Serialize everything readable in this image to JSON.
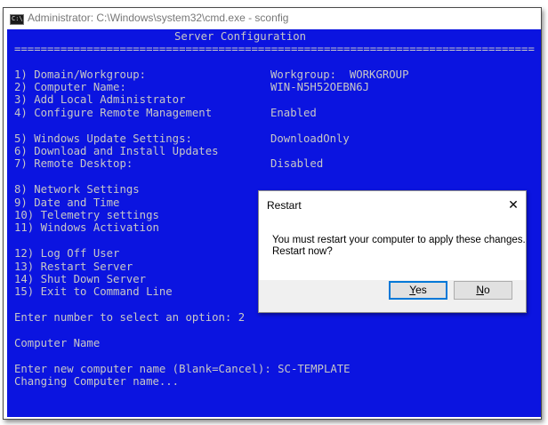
{
  "window": {
    "title": "Administrator: C:\\Windows\\system32\\cmd.exe - sconfig",
    "icon": "cmd-console-icon",
    "icon_label": "C:\\"
  },
  "console": {
    "heading": "Server Configuration",
    "separator": "===============================================================================",
    "menu": [
      {
        "label": "1) Domain/Workgroup:",
        "value": "Workgroup:  WORKGROUP"
      },
      {
        "label": "2) Computer Name:",
        "value": "WIN-N5H52OEBN6J"
      },
      {
        "label": "3) Add Local Administrator",
        "value": ""
      },
      {
        "label": "4) Configure Remote Management",
        "value": "Enabled"
      },
      {
        "label": "5) Windows Update Settings:",
        "value": "DownloadOnly"
      },
      {
        "label": "6) Download and Install Updates",
        "value": ""
      },
      {
        "label": "7) Remote Desktop:",
        "value": "Disabled"
      },
      {
        "label": "8) Network Settings",
        "value": ""
      },
      {
        "label": "9) Date and Time",
        "value": ""
      },
      {
        "label": "10) Telemetry settings",
        "value": ""
      },
      {
        "label": "11) Windows Activation",
        "value": ""
      },
      {
        "label": "12) Log Off User",
        "value": ""
      },
      {
        "label": "13) Restart Server",
        "value": ""
      },
      {
        "label": "14) Shut Down Server",
        "value": ""
      },
      {
        "label": "15) Exit to Command Line",
        "value": ""
      }
    ],
    "prompt": "Enter number to select an option: 2",
    "section": "Computer Name",
    "name_prompt": "Enter new computer name (Blank=Cancel): SC-TEMPLATE",
    "status": "Changing Computer name..."
  },
  "dialog": {
    "title": "Restart",
    "close_label": "✕",
    "message_line1": "You must restart your computer to apply these changes.",
    "message_line2": "Restart now?",
    "yes_mnemonic": "Y",
    "yes_rest": "es",
    "no_mnemonic": "N",
    "no_rest": "o"
  }
}
